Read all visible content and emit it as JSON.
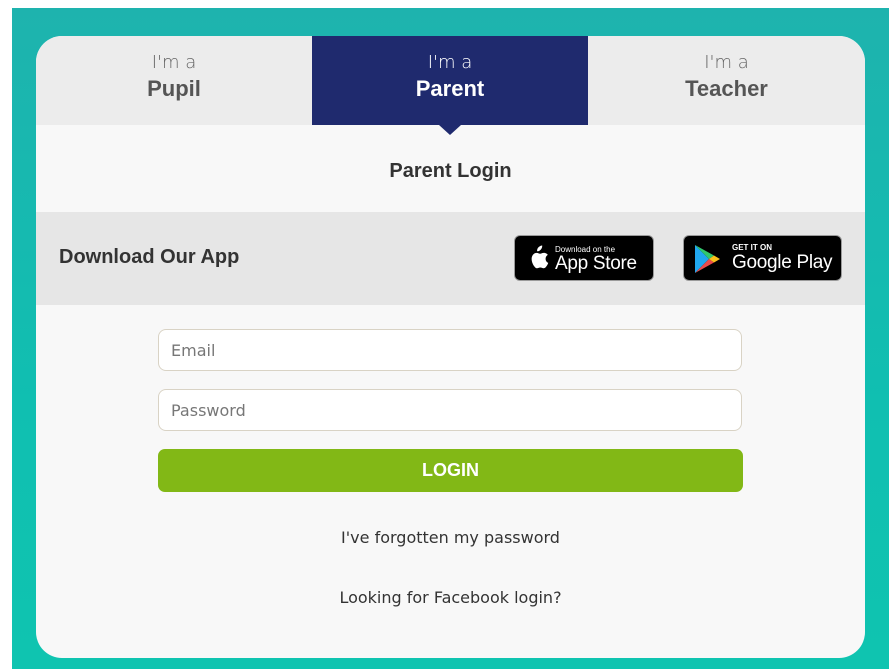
{
  "tabs": [
    {
      "prefix": "I'm a",
      "role": "Pupil"
    },
    {
      "prefix": "I'm a",
      "role": "Parent",
      "active": true
    },
    {
      "prefix": "I'm a",
      "role": "Teacher"
    }
  ],
  "login_title": "Parent Login",
  "app_section": {
    "label": "Download Our App",
    "app_store": {
      "small": "Download on the",
      "big": "App Store",
      "icon": "apple-icon"
    },
    "google_play": {
      "small": "GET IT ON",
      "big": "Google Play",
      "icon": "google-play-icon"
    }
  },
  "form": {
    "email_placeholder": "Email",
    "email_value": "",
    "password_placeholder": "Password",
    "password_value": "",
    "login_label": "LOGIN"
  },
  "links": {
    "forgot": "I've forgotten my password",
    "facebook": "Looking for Facebook login?"
  },
  "colors": {
    "background": "#10bfb1",
    "active_tab": "#1f2a6e",
    "login_button": "#82b816"
  }
}
